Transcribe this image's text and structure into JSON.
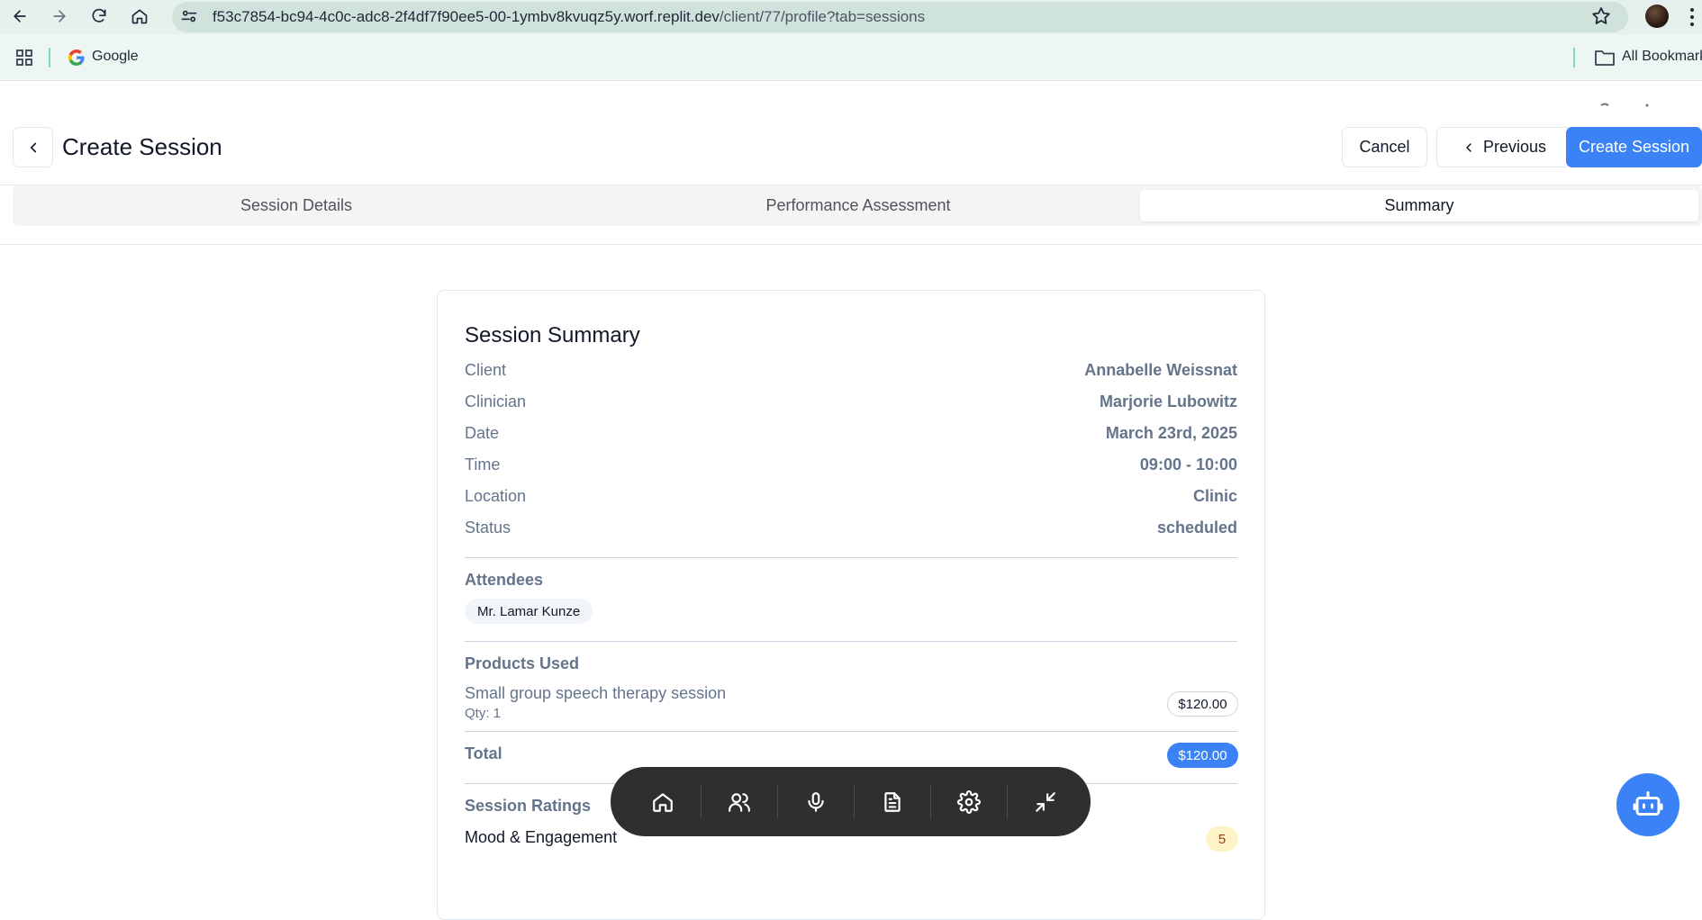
{
  "browser": {
    "url_host": "f53c7854-bc94-4c0c-adc8-2f4df7f90ee5-00-1ymbv8kvuqz5y.worf.replit.dev",
    "url_path": "/client/77/profile?tab=sessions",
    "bookmarks": [
      {
        "label": "Google",
        "icon": "google-icon"
      }
    ],
    "all_bookmarks_label": "All Bookmarks"
  },
  "header": {
    "title": "Create Session",
    "cancel_label": "Cancel",
    "previous_label": "Previous",
    "create_label": "Create Session"
  },
  "tabs": [
    {
      "label": "Session Details",
      "active": false
    },
    {
      "label": "Performance Assessment",
      "active": false
    },
    {
      "label": "Summary",
      "active": true
    }
  ],
  "summary": {
    "title": "Session Summary",
    "fields": [
      {
        "label": "Client",
        "value": "Annabelle Weissnat"
      },
      {
        "label": "Clinician",
        "value": "Marjorie Lubowitz"
      },
      {
        "label": "Date",
        "value": "March 23rd, 2025"
      },
      {
        "label": "Time",
        "value": "09:00 - 10:00"
      },
      {
        "label": "Location",
        "value": "Clinic"
      },
      {
        "label": "Status",
        "value": "scheduled"
      }
    ],
    "attendees_heading": "Attendees",
    "attendees": [
      "Mr. Lamar Kunze"
    ],
    "products_heading": "Products Used",
    "products": [
      {
        "name": "Small group speech therapy session",
        "qty": "Qty: 1",
        "price": "$120.00"
      }
    ],
    "total_label": "Total",
    "total_value": "$120.00",
    "ratings_heading": "Session Ratings",
    "ratings": [
      {
        "label": "Mood & Engagement",
        "value": "5"
      }
    ]
  },
  "dock": {
    "items": [
      "home-icon",
      "users-icon",
      "microphone-icon",
      "document-icon",
      "settings-icon",
      "minimize-icon"
    ]
  },
  "colors": {
    "primary": "#3b82f6",
    "dock_bg": "#2f2f2f",
    "rating_badge_bg": "#fef3c7"
  }
}
